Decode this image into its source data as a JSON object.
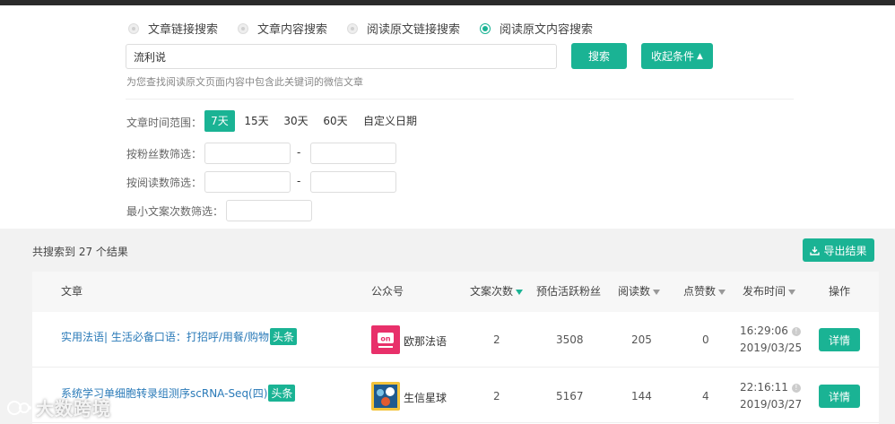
{
  "search_modes": [
    {
      "label": "文章链接搜索",
      "selected": false
    },
    {
      "label": "文章内容搜索",
      "selected": false
    },
    {
      "label": "阅读原文链接搜索",
      "selected": false
    },
    {
      "label": "阅读原文内容搜索",
      "selected": true
    }
  ],
  "search": {
    "value": "流利说",
    "button_label": "搜索",
    "collapse_label": "收起条件",
    "hint": "为您查找阅读原文页面内容中包含此关键词的微信文章"
  },
  "filters": {
    "time_range_label": "文章时间范围：",
    "time_options": [
      "7天",
      "15天",
      "30天",
      "60天",
      "自定义日期"
    ],
    "selected_time": "7天",
    "fans_label": "按粉丝数筛选：",
    "reads_label": "按阅读数筛选：",
    "min_copy_label": "最小文案次数筛选：",
    "range_separator": "-"
  },
  "results": {
    "summary": "共搜索到 27 个结果",
    "export_label": "导出结果"
  },
  "table": {
    "headers": {
      "article": "文章",
      "account": "公众号",
      "copy_count": "文案次数",
      "est_fans": "预估活跃粉丝",
      "reads": "阅读数",
      "likes": "点赞数",
      "publish_time": "发布时间",
      "action": "操作"
    },
    "rows": [
      {
        "title": "实用法语| 生活必备口语：打招呼/用餐/购物",
        "tag": "头条",
        "account": "欧那法语",
        "copy_count": "2",
        "est_fans": "3508",
        "reads": "205",
        "likes": "0",
        "time": "16:29:06",
        "date": "2019/03/25",
        "action": "详情"
      },
      {
        "title": "系统学习单细胞转录组测序scRNA-Seq(四)",
        "tag": "头条",
        "account": "生信星球",
        "copy_count": "2",
        "est_fans": "5167",
        "reads": "144",
        "likes": "4",
        "time": "22:16:11",
        "date": "2019/03/27",
        "action": "详情"
      }
    ]
  },
  "watermark": "大数跨境",
  "colors": {
    "accent": "#1ab394",
    "link": "#2a7ab8"
  }
}
